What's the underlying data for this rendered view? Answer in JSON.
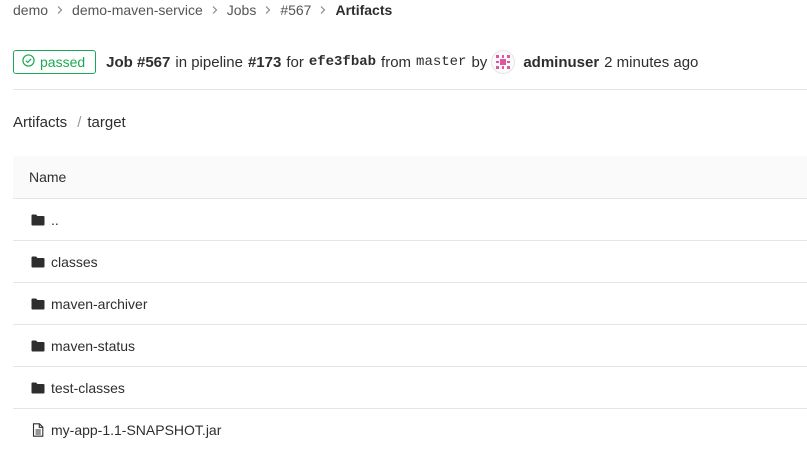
{
  "breadcrumb": {
    "items": [
      {
        "label": "demo"
      },
      {
        "label": "demo-maven-service"
      },
      {
        "label": "Jobs"
      },
      {
        "label": "#567"
      },
      {
        "label": "Artifacts"
      }
    ]
  },
  "job": {
    "status": "passed",
    "status_color": "#1aaa55",
    "job_label": "Job #567",
    "in_pipeline_text": "in pipeline",
    "pipeline_label": "#173",
    "for_text": "for",
    "commit_sha": "efe3fbab",
    "from_text": "from",
    "branch": "master",
    "by_text": "by",
    "user": "adminuser",
    "time_ago": "2 minutes ago"
  },
  "path": {
    "root": "Artifacts",
    "separator": "/",
    "current": "target"
  },
  "tree": {
    "header_name": "Name",
    "rows": [
      {
        "name": "..",
        "icon": "folder-icon"
      },
      {
        "name": "classes",
        "icon": "folder-icon"
      },
      {
        "name": "maven-archiver",
        "icon": "folder-icon"
      },
      {
        "name": "maven-status",
        "icon": "folder-icon"
      },
      {
        "name": "test-classes",
        "icon": "folder-icon"
      },
      {
        "name": "my-app-1.1-SNAPSHOT.jar",
        "icon": "file-icon"
      }
    ]
  }
}
